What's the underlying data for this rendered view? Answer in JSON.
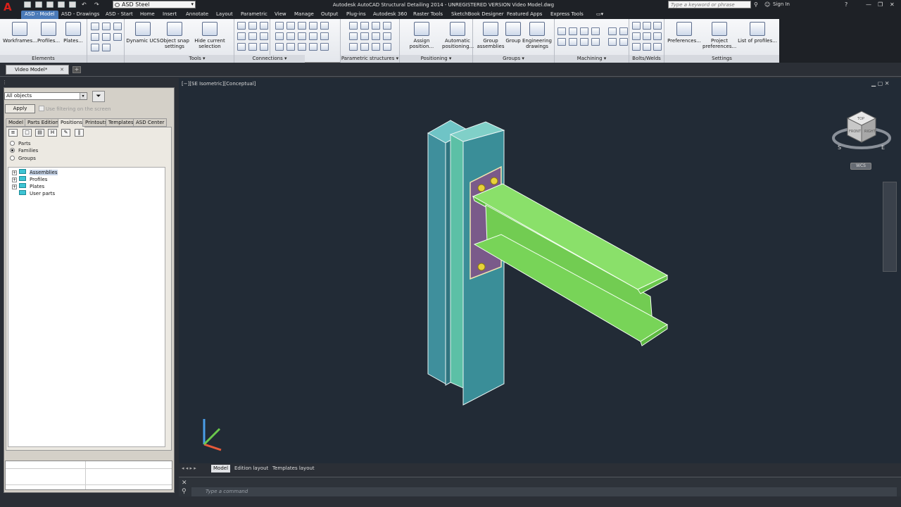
{
  "app": {
    "title": "Autodesk AutoCAD Structural Detailing 2014 - UNREGISTERED VERSION   Video Model.dwg",
    "logo_text": "A",
    "workspace": "ASD Steel",
    "search_placeholder": "Type a keyword or phrase",
    "sign_in": "Sign In"
  },
  "ribbon_tabs": [
    "ASD - Model",
    "ASD - Drawings",
    "ASD - Start",
    "Home",
    "Insert",
    "Annotate",
    "Layout",
    "Parametric",
    "View",
    "Manage",
    "Output",
    "Plug-ins",
    "Autodesk 360",
    "Raster Tools",
    "SketchBook Designer",
    "Featured Apps",
    "Express Tools"
  ],
  "ribbon": {
    "elements": {
      "title": "Elements",
      "workframes": "Workframes...",
      "profiles": "Profiles...",
      "plates": "Plates..."
    },
    "tools": {
      "title": "Tools",
      "dynamic_ucs": "Dynamic UCS",
      "object_snap": "Object snap settings",
      "hide_selection": "Hide current selection"
    },
    "connections": {
      "title": "Connections"
    },
    "parametric": {
      "title": "Parametric structures"
    },
    "positioning": {
      "title": "Positioning",
      "assign": "Assign position...",
      "automatic": "Automatic positioning..."
    },
    "groups": {
      "title": "Groups",
      "group_assemblies": "Group assemblies",
      "group": "Group",
      "engineering": "Engineering drawings"
    },
    "machining": {
      "title": "Machining"
    },
    "bolts": {
      "title": "Bolts/Welds"
    },
    "settings": {
      "title": "Settings",
      "preferences": "Preferences...",
      "project_prefs": "Project preferences...",
      "list_profiles": "List of profiles..."
    }
  },
  "document": {
    "tab": "Video Model*"
  },
  "palette": {
    "filter_value": "All objects",
    "apply": "Apply",
    "use_filtering": "Use filtering on the screen",
    "tabs": [
      "Model",
      "Parts Edition",
      "Positions",
      "Printouts",
      "Templates",
      "ASD Center"
    ],
    "active_tab": "Positions",
    "radios": [
      {
        "label": "Parts",
        "checked": false
      },
      {
        "label": "Families",
        "checked": true
      },
      {
        "label": "Groups",
        "checked": false
      }
    ],
    "tree": [
      "Assemblies",
      "Profiles",
      "Plates",
      "User parts"
    ]
  },
  "viewport": {
    "label": "[−][SE Isometric][Conceptual]",
    "wcs": "WCS",
    "viewcube": {
      "top": "TOP",
      "front": "FRONT",
      "right": "RIGHT",
      "compass": [
        "S",
        "E"
      ]
    },
    "colors": {
      "column": "#4a9ea8",
      "beam": "#7ed35a",
      "plate": "#7a5a8a",
      "bolt": "#e8d23a",
      "background": "#222b36"
    }
  },
  "layouts": [
    "Model",
    "Edition layout",
    "Templates layout"
  ],
  "command": {
    "placeholder": "Type a command"
  }
}
